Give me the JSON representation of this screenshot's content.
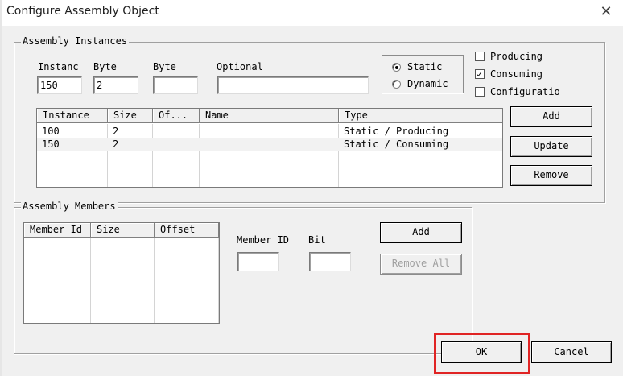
{
  "window": {
    "title": "Configure Assembly Object",
    "close_glyph": "✕"
  },
  "assembly_instances": {
    "legend": "Assembly Instances",
    "fields": {
      "instance": {
        "label": "Instanc",
        "value": "150"
      },
      "byte1": {
        "label": "Byte",
        "value": "2"
      },
      "byte2": {
        "label": "Byte",
        "value": ""
      },
      "optional": {
        "label": "Optional",
        "value": ""
      }
    },
    "type_radio": {
      "static_label": "Static",
      "dynamic_label": "Dynamic",
      "selected": "Static"
    },
    "checkboxes": {
      "producing": {
        "label": "Producing",
        "checked": false,
        "glyph": ""
      },
      "consuming": {
        "label": "Consuming",
        "checked": true,
        "glyph": "✓"
      },
      "configuration": {
        "label": "Configuratio",
        "checked": false,
        "glyph": ""
      }
    },
    "table": {
      "columns": [
        "Instance",
        "Size",
        "Of...",
        "Name",
        "Type"
      ],
      "rows": [
        {
          "instance": "100",
          "size": "2",
          "offset": "",
          "name": "",
          "type": "Static / Producing"
        },
        {
          "instance": "150",
          "size": "2",
          "offset": "",
          "name": "",
          "type": "Static / Consuming"
        }
      ]
    },
    "buttons": {
      "add": "Add",
      "update": "Update",
      "remove": "Remove"
    }
  },
  "assembly_members": {
    "legend": "Assembly Members",
    "table": {
      "columns": [
        "Member Id",
        "Size",
        "Offset"
      ],
      "rows": []
    },
    "fields": {
      "member_id": {
        "label": "Member ID",
        "value": ""
      },
      "bit": {
        "label": "Bit",
        "value": ""
      }
    },
    "buttons": {
      "add": "Add",
      "remove_all": "Remove All"
    }
  },
  "footer": {
    "ok": "OK",
    "cancel": "Cancel"
  },
  "colors": {
    "highlight": "#e02424",
    "dialog_bg": "#f0f0f0"
  }
}
